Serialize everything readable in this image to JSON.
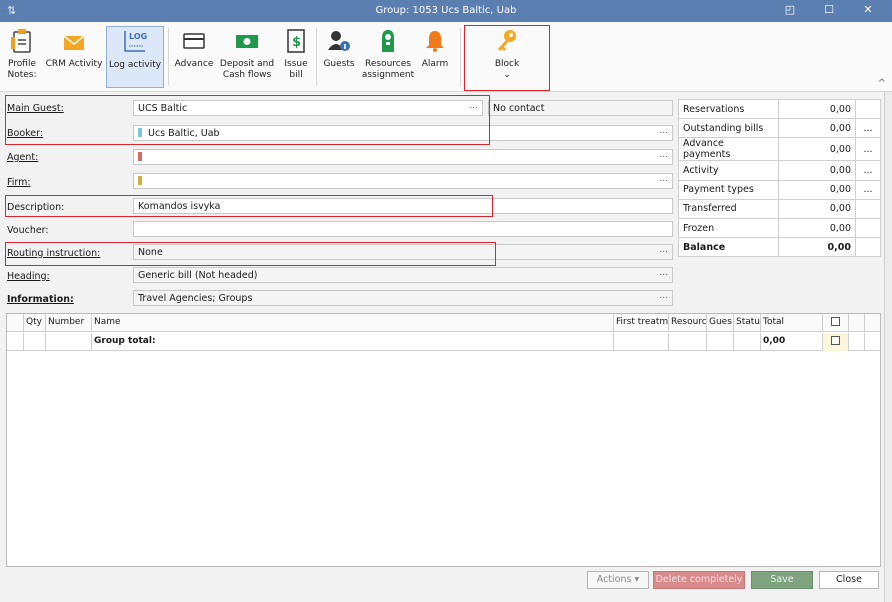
{
  "window": {
    "title": "Group: 1053 Ucs Baltic, Uab",
    "restore_glyph": "◰",
    "minimize_glyph": "☐",
    "close_glyph": "✕"
  },
  "ribbon": {
    "buttons": [
      {
        "label_1": "Profile",
        "label_2": "Notes:",
        "icon": "clipboard-icon"
      },
      {
        "label_1": "CRM Activity",
        "label_2": "",
        "icon": "envelope-icon"
      },
      {
        "label_1": "Log activity",
        "label_2": "",
        "icon": "log-document-icon",
        "icon_text": "LOG"
      },
      {
        "label_1": "Advance",
        "label_2": "",
        "icon": "card-icon"
      },
      {
        "label_1": "Deposit and",
        "label_2": "Cash flows",
        "icon": "banknote-icon"
      },
      {
        "label_1": "Issue",
        "label_2": "bill",
        "icon": "dollar-bill-icon",
        "icon_text": "$"
      },
      {
        "label_1": "Guests",
        "label_2": "",
        "icon": "guest-info-icon"
      },
      {
        "label_1": "Resources",
        "label_2": "assignment",
        "icon": "door-hanger-icon"
      },
      {
        "label_1": "Alarm",
        "label_2": "",
        "icon": "bell-icon"
      },
      {
        "label_1": "Block",
        "label_2": "",
        "icon": "key-icon"
      }
    ],
    "block_dropdown_glyph": "⌄",
    "collapse_glyph": "^"
  },
  "form": {
    "main_guest": {
      "label": "Main Guest:",
      "value": "UCS Baltic",
      "contact": "No contact"
    },
    "booker": {
      "label": "Booker:",
      "value": "Ucs Baltic, Uab",
      "color": "#7fc6d8"
    },
    "agent": {
      "label": "Agent:",
      "value": "",
      "color": "#d46a6a"
    },
    "firm": {
      "label": "Firm:",
      "value": "",
      "color": "#c9b13a"
    },
    "description": {
      "label": "Description:",
      "value": "Komandos isvyka"
    },
    "voucher": {
      "label": "Voucher:",
      "value": ""
    },
    "routing": {
      "label": "Routing instruction:",
      "value": "None"
    },
    "heading": {
      "label": "Heading:",
      "value": "Generic bill (Not headed)"
    },
    "information": {
      "label": "Information:",
      "value": "Travel Agencies; Groups"
    },
    "ellipsis": "..."
  },
  "summary": [
    {
      "label": "Reservations",
      "value": "0,00",
      "more": ""
    },
    {
      "label": "Outstanding bills",
      "value": "0,00",
      "more": "..."
    },
    {
      "label": "Advance payments",
      "value": "0,00",
      "more": "..."
    },
    {
      "label": "Activity",
      "value": "0,00",
      "more": "..."
    },
    {
      "label": "Payment types",
      "value": "0,00",
      "more": "..."
    },
    {
      "label": "Transferred",
      "value": "0,00",
      "more": ""
    },
    {
      "label": "Frozen",
      "value": "0,00",
      "more": ""
    },
    {
      "label": "Balance",
      "value": "0,00",
      "more": ""
    }
  ],
  "grid": {
    "columns": [
      "",
      "Qty",
      "Number",
      "Name",
      "First treatm",
      "Resourc",
      "Gues",
      "Statu",
      "Total",
      "",
      ""
    ],
    "total_row": {
      "label": "Group total:",
      "total": "0,00"
    }
  },
  "footer": {
    "actions": "Actions",
    "actions_caret": "▾",
    "delete": "Delete completely",
    "save": "Save",
    "close": "Close"
  }
}
